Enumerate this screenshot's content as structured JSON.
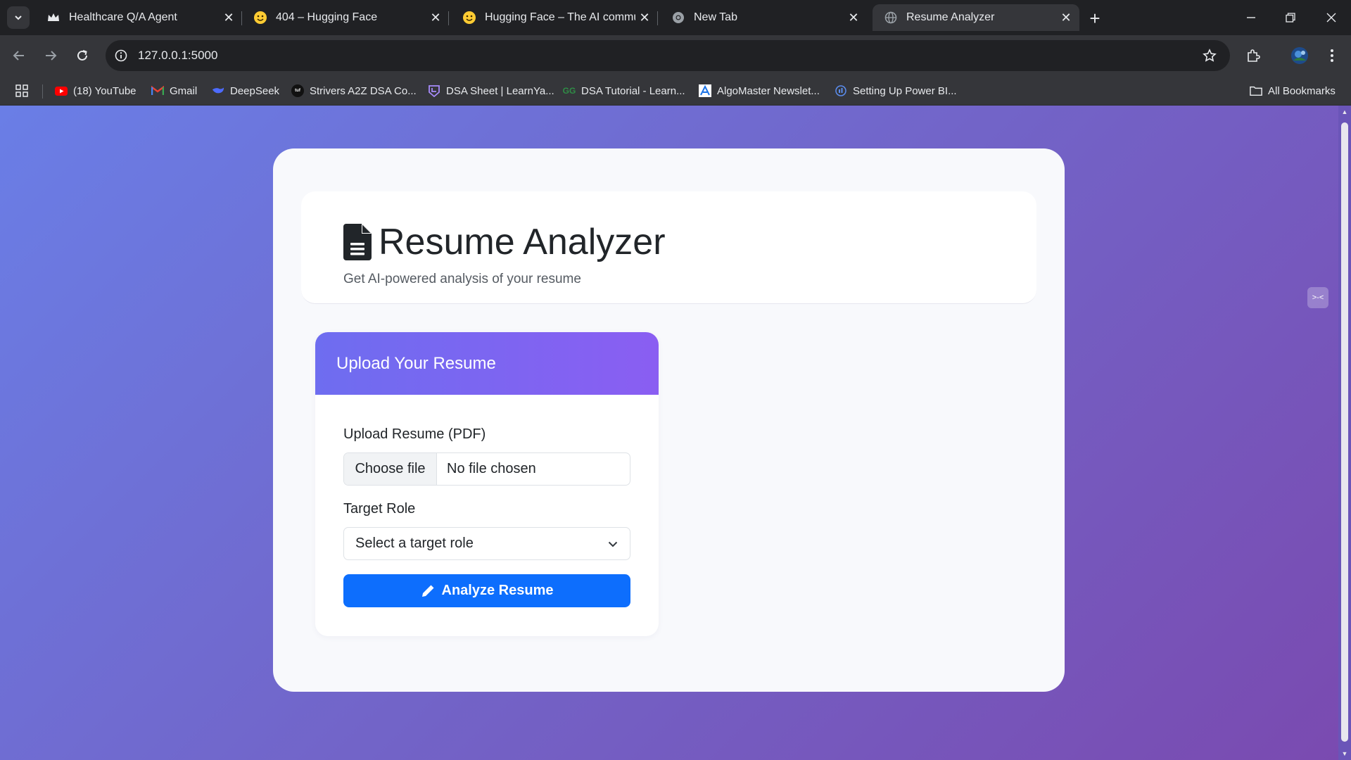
{
  "browser": {
    "tabs": [
      {
        "title": "Healthcare Q/A Agent",
        "active": false
      },
      {
        "title": "404 – Hugging Face",
        "active": false
      },
      {
        "title": "Hugging Face – The AI community building the future",
        "active": false
      },
      {
        "title": "New Tab",
        "active": false
      },
      {
        "title": "Resume Analyzer",
        "active": true
      }
    ],
    "url": "127.0.0.1:5000",
    "bookmarks": [
      {
        "label": "(18) YouTube",
        "icon": "youtube-icon"
      },
      {
        "label": "Gmail",
        "icon": "gmail-icon"
      },
      {
        "label": "DeepSeek",
        "icon": "deepseek-icon"
      },
      {
        "label": "Strivers A2Z DSA Co...",
        "icon": "tuf-icon"
      },
      {
        "label": "DSA Sheet | LearnYa...",
        "icon": "learnyard-icon"
      },
      {
        "label": "DSA Tutorial - Learn...",
        "icon": "gfg-icon"
      },
      {
        "label": "AlgoMaster Newslet...",
        "icon": "algomaster-icon"
      },
      {
        "label": "Setting Up Power BI...",
        "icon": "powerbi-icon"
      }
    ],
    "all_bookmarks_label": "All Bookmarks"
  },
  "page": {
    "title": "Resume Analyzer",
    "subtitle": "Get AI-powered analysis of your resume",
    "upload_card": {
      "heading": "Upload Your Resume",
      "file_label": "Upload Resume (PDF)",
      "choose_file_label": "Choose file",
      "file_status": "No file chosen",
      "role_label": "Target Role",
      "role_selected": "Select a target role",
      "analyze_label": "Analyze Resume"
    }
  },
  "colors": {
    "accent_button": "#0d6efd",
    "card_header_gradient_start": "#6e6df0",
    "card_header_gradient_end": "#8a5ef2",
    "background_gradient_start": "#6a7ee6",
    "background_gradient_end": "#7a4ab0"
  }
}
